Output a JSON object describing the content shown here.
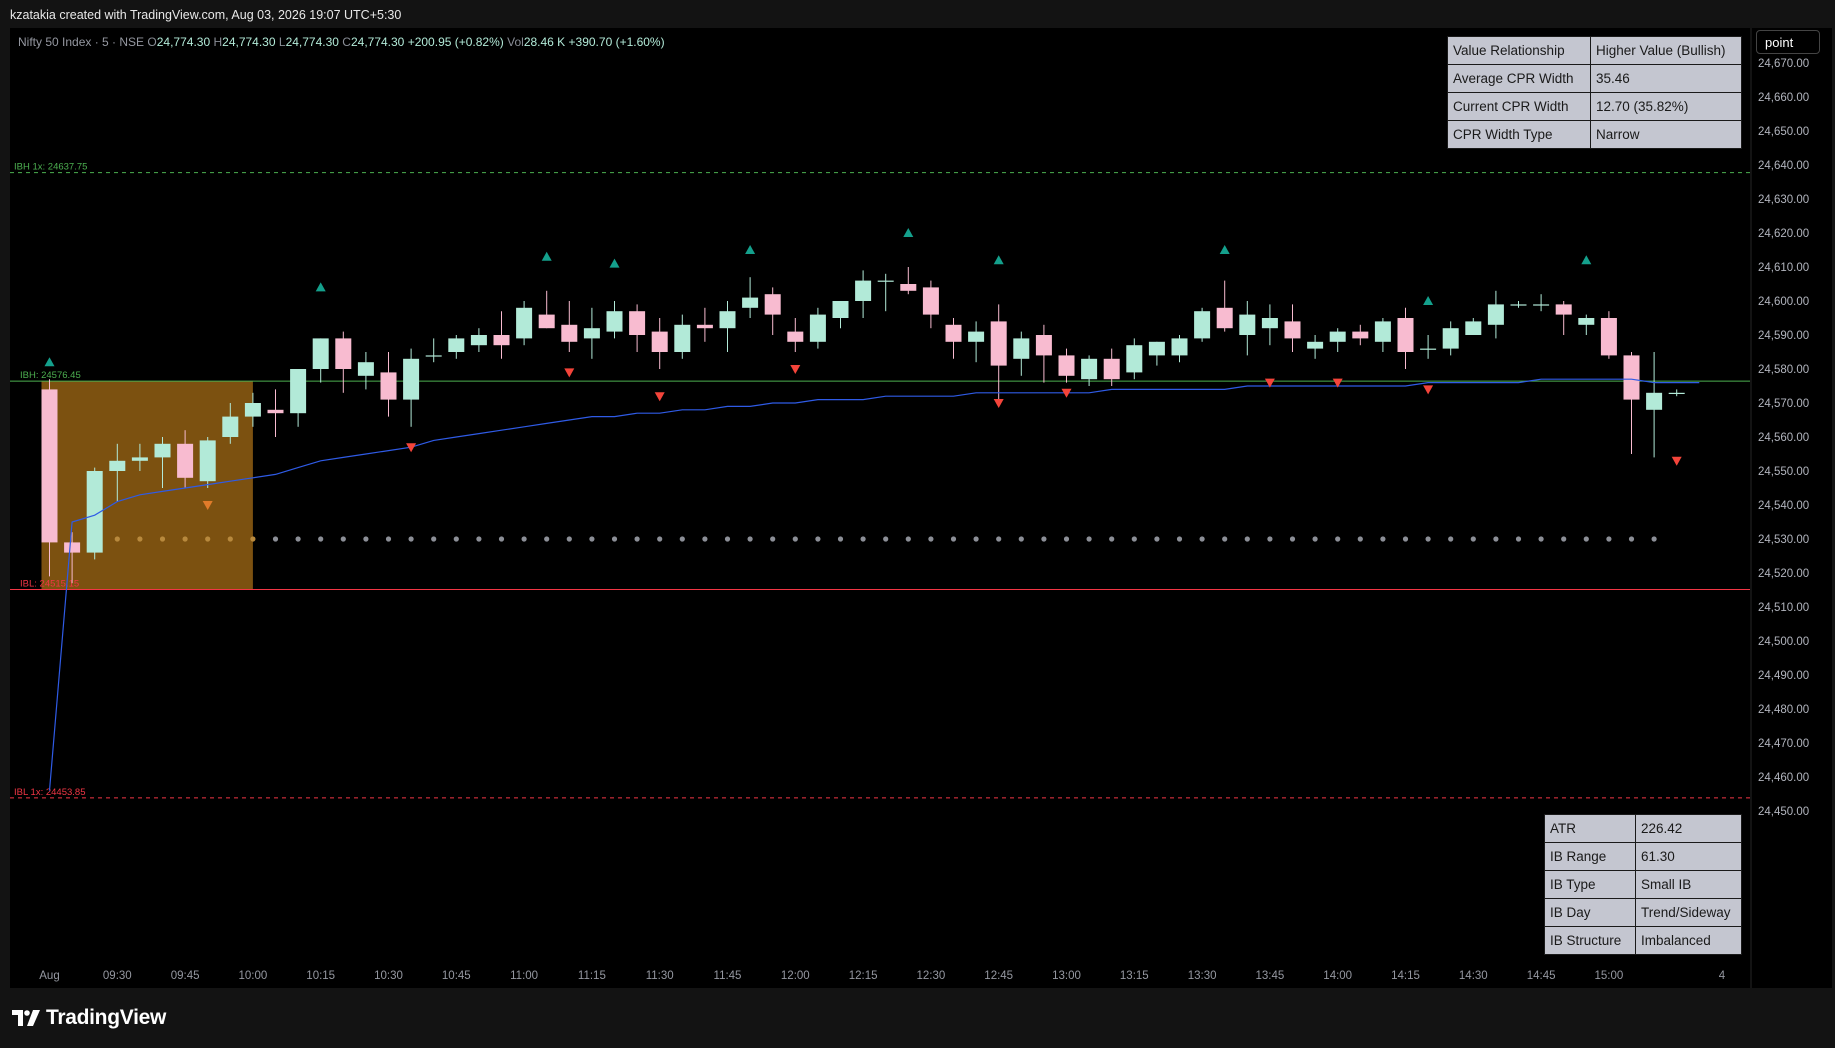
{
  "header_text": "kzatakia created with TradingView.com, Aug 03, 2026 19:07 UTC+5:30",
  "legend": {
    "symbol": "Nifty 50 Index · 5 · NSE",
    "o_label": "O",
    "o": "24,774.30",
    "h_label": "H",
    "h": "24,774.30",
    "l_label": "L",
    "l": "24,774.30",
    "c_label": "C",
    "c": "24,774.30",
    "change": "+200.95 (+0.82%)",
    "vol_label": "Vol",
    "vol": "28.46 K",
    "vol_change": "+390.70 (+1.60%)"
  },
  "unit_button": "point",
  "footer_logo": "TradingView",
  "colors": {
    "bg": "#000000",
    "up": "#b2ead8",
    "down": "#f8bbd0",
    "ib_box": "#8a5a12",
    "vwap": "#2f5be6",
    "ibh": "#4caf50",
    "ibl": "#f23645",
    "tri_up": "#14a08c",
    "tri_down": "#f4443a",
    "dots": "#8c8f97"
  },
  "table_top": [
    {
      "key": "Value Relationship",
      "val": "Higher Value (Bullish)"
    },
    {
      "key": "Average CPR Width",
      "val": "35.46"
    },
    {
      "key": "Current CPR Width",
      "val": "12.70 (35.82%)"
    },
    {
      "key": "CPR Width Type",
      "val": "Narrow"
    }
  ],
  "table_bottom": [
    {
      "key": "ATR",
      "val": "226.42"
    },
    {
      "key": "IB Range",
      "val": "61.30"
    },
    {
      "key": "IB Type",
      "val": "Small IB"
    },
    {
      "key": "IB Day",
      "val": "Trend/Sideway"
    },
    {
      "key": "IB Structure",
      "val": "Imbalanced"
    }
  ],
  "chart_data": {
    "type": "candlestick",
    "symbol": "Nifty 50 Index",
    "interval": "5",
    "exchange": "NSE",
    "ylim": [
      24445,
      24675
    ],
    "y_ticks": [
      24450,
      24460,
      24470,
      24480,
      24490,
      24500,
      24510,
      24520,
      24530,
      24540,
      24550,
      24560,
      24570,
      24580,
      24590,
      24600,
      24610,
      24620,
      24630,
      24640,
      24650,
      24660,
      24670
    ],
    "y_tick_labels": [
      "24,450.00",
      "24,460.00",
      "24,470.00",
      "24,480.00",
      "24,490.00",
      "24,500.00",
      "24,510.00",
      "24,520.00",
      "24,530.00",
      "24,540.00",
      "24,550.00",
      "24,560.00",
      "24,570.00",
      "24,580.00",
      "24,590.00",
      "24,600.00",
      "24,610.00",
      "24,620.00",
      "24,630.00",
      "24,640.00",
      "24,650.00",
      "24,660.00",
      "24,670.00"
    ],
    "x_tick_labels": [
      "Aug",
      "09:30",
      "09:45",
      "10:00",
      "10:15",
      "10:30",
      "10:45",
      "11:00",
      "11:15",
      "11:30",
      "11:45",
      "12:00",
      "12:15",
      "12:30",
      "12:45",
      "13:00",
      "13:15",
      "13:30",
      "13:45",
      "14:00",
      "14:15",
      "14:30",
      "14:45",
      "15:00",
      "4"
    ],
    "x_tick_index": [
      0,
      3,
      6,
      9,
      12,
      15,
      18,
      21,
      24,
      27,
      30,
      33,
      36,
      39,
      42,
      45,
      48,
      51,
      54,
      57,
      60,
      63,
      66,
      69,
      74
    ],
    "candles": [
      [
        24574,
        24577,
        24519,
        24529
      ],
      [
        24529,
        24532,
        24517,
        24526
      ],
      [
        24526,
        24551,
        24524,
        24550
      ],
      [
        24550,
        24558,
        24541,
        24553
      ],
      [
        24553,
        24558,
        24550,
        24554
      ],
      [
        24554,
        24560,
        24545,
        24558
      ],
      [
        24558,
        24562,
        24545,
        24548
      ],
      [
        24547,
        24560,
        24545,
        24559
      ],
      [
        24560,
        24570,
        24558,
        24566
      ],
      [
        24566,
        24573,
        24563,
        24570
      ],
      [
        24568,
        24574,
        24560,
        24567
      ],
      [
        24567,
        24577,
        24563,
        24580
      ],
      [
        24580,
        24589,
        24576,
        24589
      ],
      [
        24589,
        24591,
        24573,
        24580
      ],
      [
        24578,
        24585,
        24574,
        24582
      ],
      [
        24579,
        24585,
        24566,
        24571
      ],
      [
        24571,
        24586,
        24563,
        24583
      ],
      [
        24584,
        24589,
        24582,
        24584
      ],
      [
        24585,
        24590,
        24583,
        24589
      ],
      [
        24587,
        24592,
        24585,
        24590
      ],
      [
        24590,
        24597,
        24583,
        24587
      ],
      [
        24589,
        24600,
        24587,
        24598
      ],
      [
        24596,
        24603,
        24592,
        24592
      ],
      [
        24593,
        24600,
        24585,
        24588
      ],
      [
        24589,
        24598,
        24583,
        24592
      ],
      [
        24591,
        24600,
        24589,
        24597
      ],
      [
        24597,
        24599,
        24585,
        24590
      ],
      [
        24591,
        24595,
        24580,
        24585
      ],
      [
        24585,
        24596,
        24583,
        24593
      ],
      [
        24593,
        24598,
        24588,
        24592
      ],
      [
        24592,
        24600,
        24585,
        24597
      ],
      [
        24598,
        24607,
        24595,
        24601
      ],
      [
        24602,
        24604,
        24590,
        24596
      ],
      [
        24591,
        24595,
        24585,
        24588
      ],
      [
        24588,
        24598,
        24586,
        24596
      ],
      [
        24595,
        24600,
        24592,
        24600
      ],
      [
        24600,
        24609,
        24595,
        24606
      ],
      [
        24606,
        24608,
        24597,
        24606
      ],
      [
        24605,
        24610,
        24602,
        24603
      ],
      [
        24604,
        24606,
        24592,
        24596
      ],
      [
        24593,
        24595,
        24583,
        24588
      ],
      [
        24588,
        24594,
        24582,
        24591
      ],
      [
        24594,
        24599,
        24570,
        24581
      ],
      [
        24583,
        24591,
        24578,
        24589
      ],
      [
        24590,
        24593,
        24576,
        24584
      ],
      [
        24584,
        24586,
        24576,
        24578
      ],
      [
        24577,
        24584,
        24575,
        24583
      ],
      [
        24583,
        24586,
        24575,
        24577
      ],
      [
        24579,
        24589,
        24577,
        24587
      ],
      [
        24584,
        24588,
        24581,
        24588
      ],
      [
        24584,
        24590,
        24582,
        24589
      ],
      [
        24589,
        24598,
        24588,
        24597
      ],
      [
        24598,
        24606,
        24591,
        24592
      ],
      [
        24590,
        24600,
        24584,
        24596
      ],
      [
        24592,
        24599,
        24587,
        24595
      ],
      [
        24594,
        24599,
        24585,
        24589
      ],
      [
        24586,
        24590,
        24583,
        24588
      ],
      [
        24588,
        24592,
        24585,
        24591
      ],
      [
        24591,
        24593,
        24587,
        24589
      ],
      [
        24588,
        24595,
        24585,
        24594
      ],
      [
        24595,
        24598,
        24580,
        24585
      ],
      [
        24586,
        24590,
        24583,
        24586
      ],
      [
        24586,
        24594,
        24584,
        24592
      ],
      [
        24590,
        24595,
        24590,
        24594
      ],
      [
        24593,
        24603,
        24589,
        24599
      ],
      [
        24599,
        24600,
        24598,
        24599
      ],
      [
        24599,
        24602,
        24597,
        24599
      ],
      [
        24599,
        24600,
        24590,
        24596
      ],
      [
        24593,
        24596,
        24590,
        24595
      ],
      [
        24595,
        24597,
        24583,
        24584
      ],
      [
        24584,
        24585,
        24555,
        24571
      ],
      [
        24568,
        24585,
        24554,
        24573
      ],
      [
        24573,
        24574,
        24572,
        24573
      ]
    ],
    "vwap": [
      24456,
      24535,
      24537,
      24541,
      24543,
      24544,
      24545,
      24546,
      24547,
      24548,
      24549,
      24551,
      24553,
      24554,
      24555,
      24556,
      24557,
      24559,
      24560,
      24561,
      24562,
      24563,
      24564,
      24565,
      24566,
      24566,
      24567,
      24567,
      24568,
      24568,
      24569,
      24569,
      24570,
      24570,
      24571,
      24571,
      24571,
      24572,
      24572,
      24572,
      24572,
      24573,
      24573,
      24573,
      24573,
      24573,
      24573,
      24574,
      24574,
      24574,
      24574,
      24574,
      24574,
      24575,
      24575,
      24575,
      24575,
      24575,
      24575,
      24575,
      24575,
      24576,
      24576,
      24576,
      24576,
      24576,
      24577,
      24577,
      24577,
      24577,
      24577,
      24576,
      24576,
      24576
    ],
    "ib_high": 24576.45,
    "ib_low": 24515.15,
    "ibh_1x": 24637.75,
    "ibl_1x": 24453.85,
    "ibh_label": "IBH: 24576.45",
    "ibl_label": "IBL: 24515.15",
    "ibh1x_label": "IBH 1x: 24637.75",
    "ibl1x_label": "IBL 1x: 24453.85",
    "ib_box_bars": [
      0,
      9
    ],
    "dots_level": 24530,
    "signals_up": [
      [
        0,
        24582
      ],
      [
        12,
        24604
      ],
      [
        22,
        24613
      ],
      [
        25,
        24611
      ],
      [
        31,
        24615
      ],
      [
        38,
        24620
      ],
      [
        42,
        24612
      ],
      [
        52,
        24615
      ],
      [
        61,
        24600
      ],
      [
        68,
        24612
      ]
    ],
    "signals_down": [
      [
        7,
        24540
      ],
      [
        16,
        24557
      ],
      [
        23,
        24579
      ],
      [
        27,
        24572
      ],
      [
        33,
        24580
      ],
      [
        42,
        24570
      ],
      [
        45,
        24573
      ],
      [
        54,
        24576
      ],
      [
        57,
        24576
      ],
      [
        61,
        24574
      ],
      [
        72,
        24553
      ]
    ]
  }
}
